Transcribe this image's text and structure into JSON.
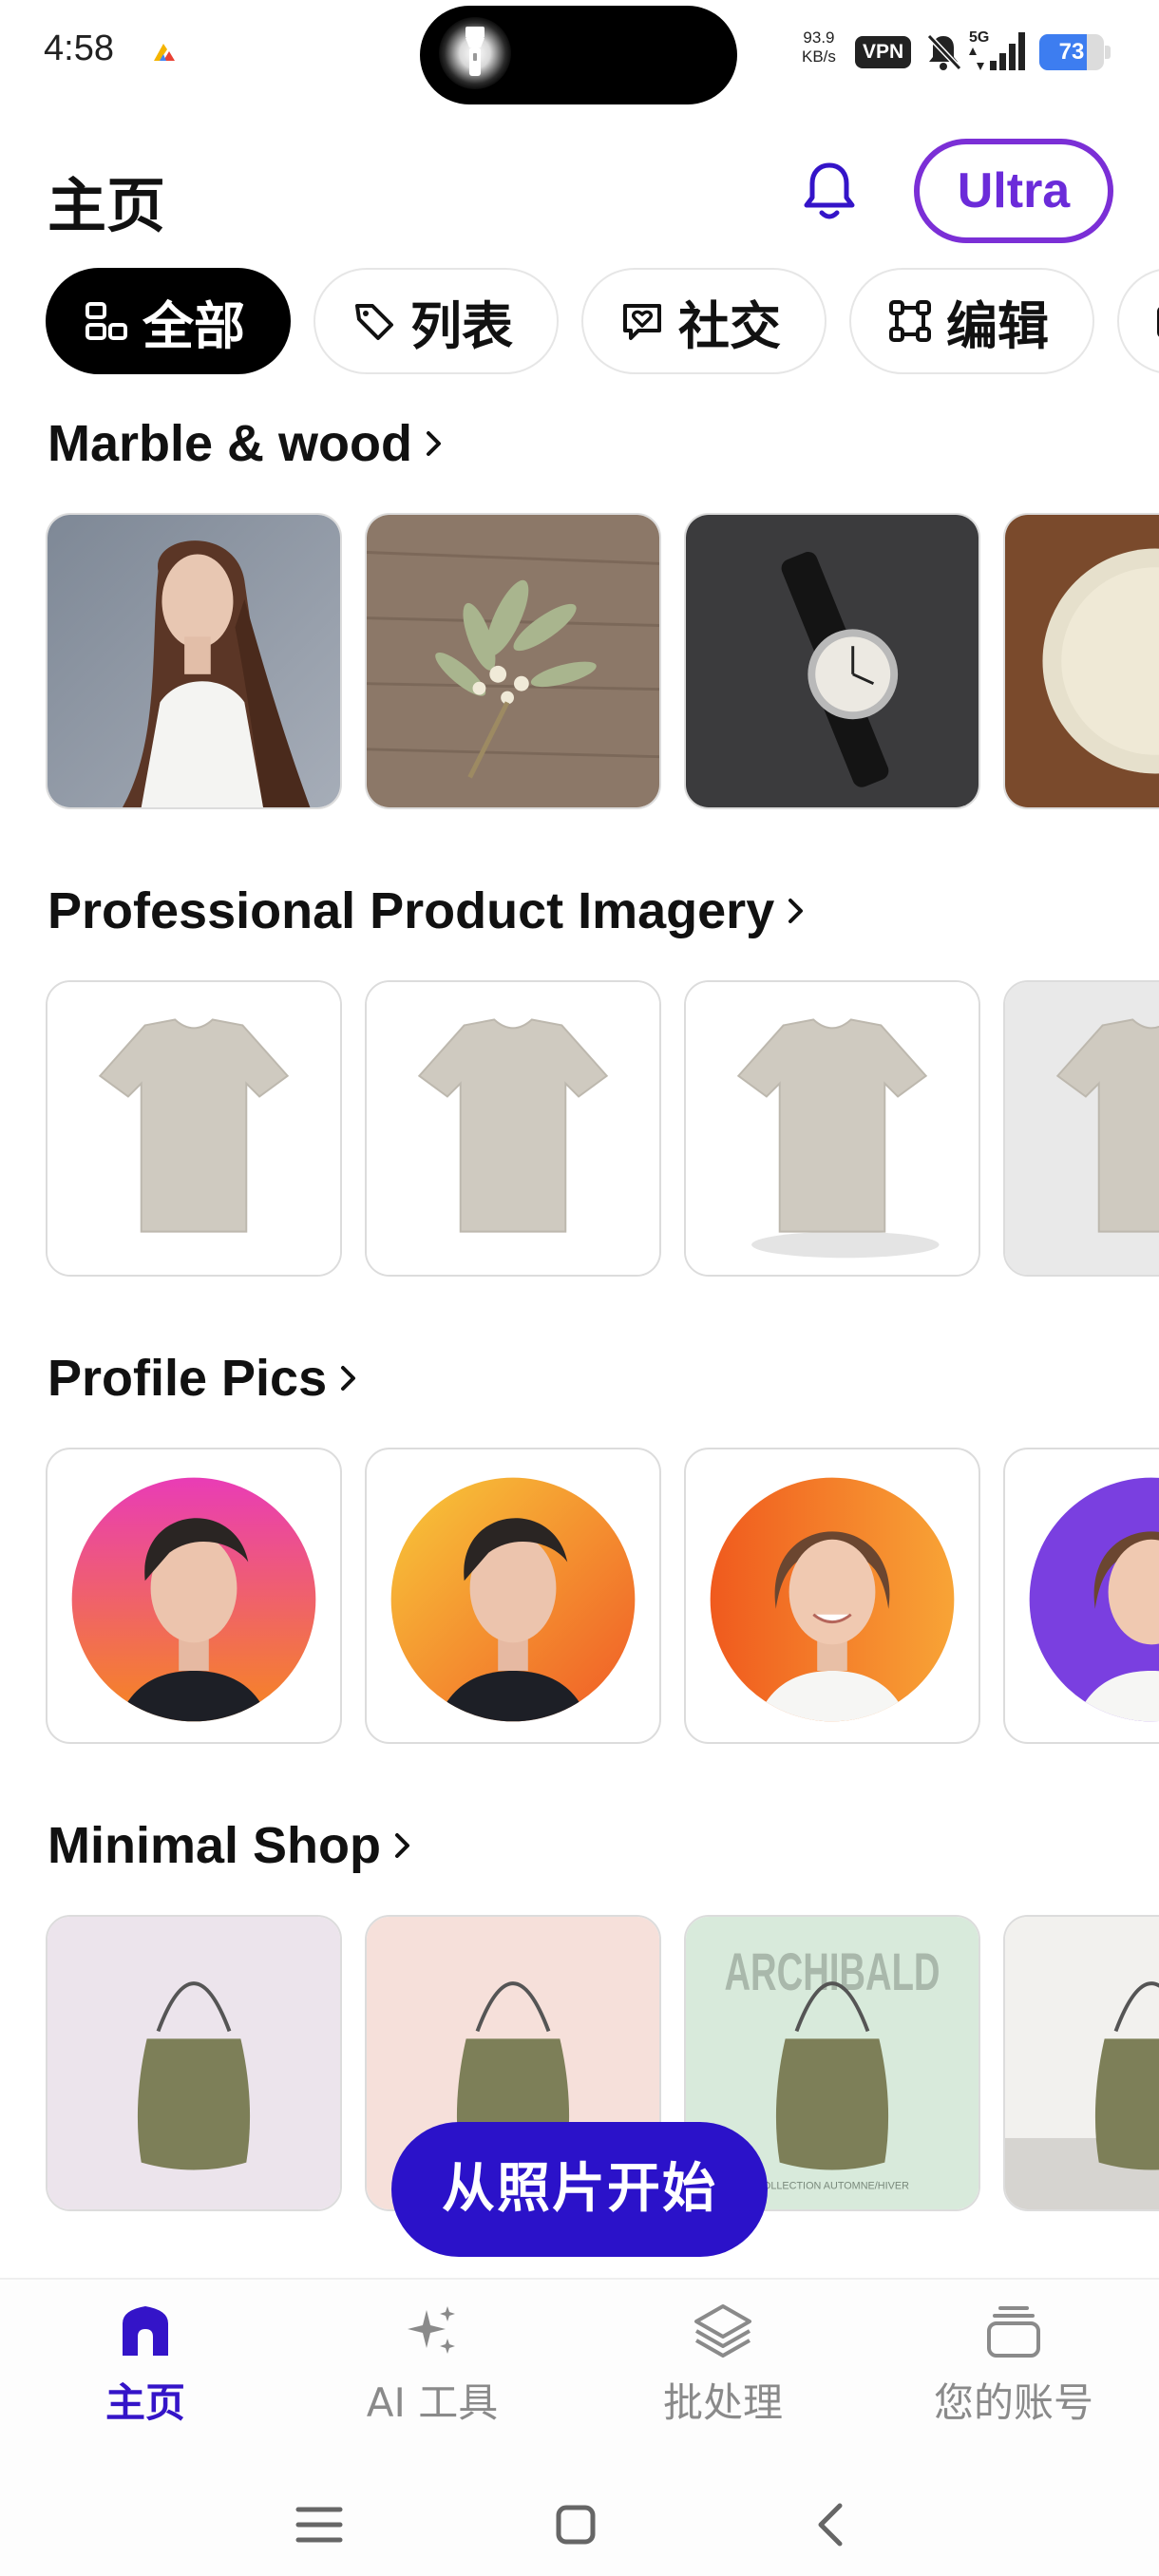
{
  "status_bar": {
    "time": "4:58",
    "net_speed_value": "93.9",
    "net_speed_unit": "KB/s",
    "vpn": "VPN",
    "network": "5G",
    "battery": "73",
    "battery_level": 0.73,
    "accent": "#3d7df0"
  },
  "header": {
    "title": "主页",
    "ultra_label": "Ultra",
    "brand_color": "#6b2bd9"
  },
  "chips": [
    {
      "label": "全部",
      "icon": "grid-icon",
      "active": true
    },
    {
      "label": "列表",
      "icon": "tag-icon",
      "active": false
    },
    {
      "label": "社交",
      "icon": "heart-chat-icon",
      "active": false
    },
    {
      "label": "编辑",
      "icon": "crop-icon",
      "active": false
    }
  ],
  "sections": [
    {
      "title": "Marble & wood",
      "cards": [
        "portrait-woman",
        "dried-flowers-on-wood",
        "watch-on-slate",
        "ceramic-plate-on-wood"
      ]
    },
    {
      "title": "Professional Product Imagery",
      "cards": [
        "tshirt-white-bg",
        "tshirt-white-bg",
        "tshirt-white-shadow",
        "tshirt-grey-bg"
      ]
    },
    {
      "title": "Profile Pics",
      "cards": [
        "avatar-pink-orange",
        "avatar-yellow-orange",
        "avatar-orange-smile",
        "avatar-purple"
      ]
    },
    {
      "title": "Minimal Shop",
      "cards": [
        "bag-lavender",
        "bag-peach",
        "bag-mint",
        "bag-studio"
      ],
      "poster_word": "ARCHIBALD",
      "poster_subtitle": "COLLECTION AUTOMNE/HIVER"
    }
  ],
  "fab": {
    "label": "从照片开始",
    "color": "#2b12c9"
  },
  "bottom_nav": [
    {
      "label": "主页",
      "icon": "home-icon",
      "active": true
    },
    {
      "label": "AI 工具",
      "icon": "sparkle-icon",
      "active": false
    },
    {
      "label": "批处理",
      "icon": "layers-icon",
      "active": false
    },
    {
      "label": "您的账号",
      "icon": "account-icon",
      "active": false
    }
  ]
}
